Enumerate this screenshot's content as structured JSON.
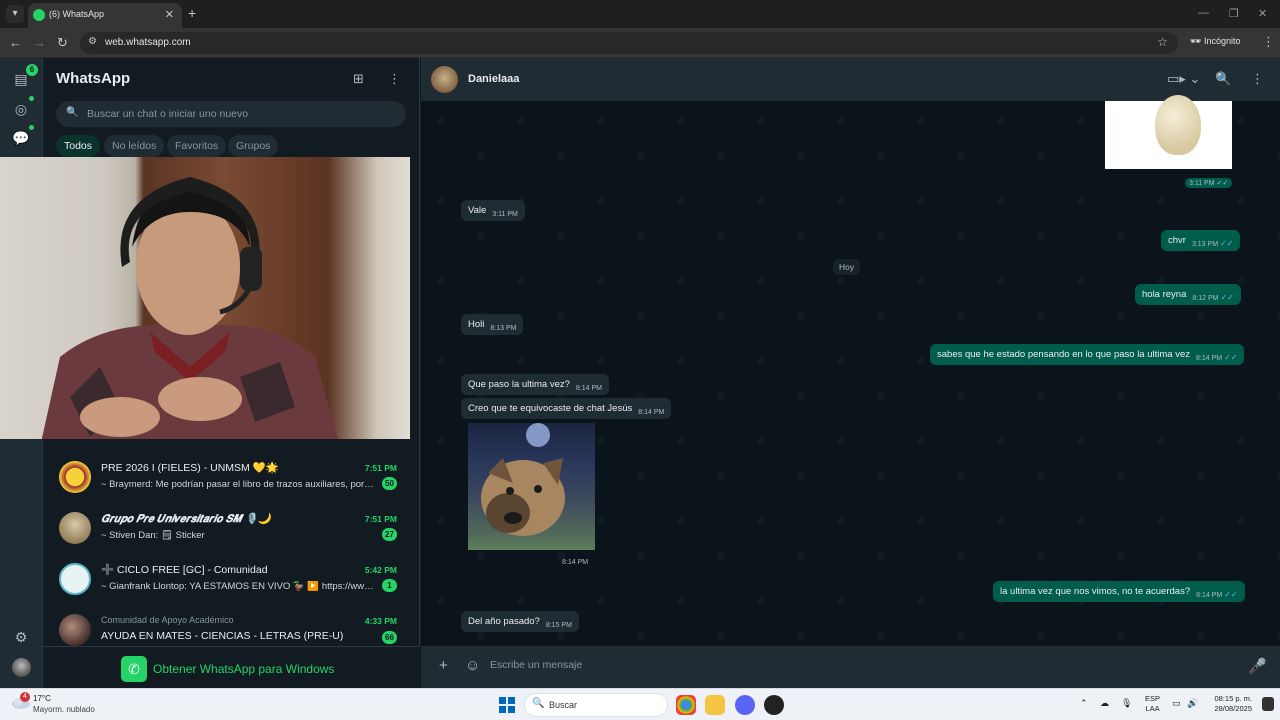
{
  "browser": {
    "tab_title": "(6) WhatsApp",
    "url": "web.whatsapp.com",
    "incognito_label": "Incógnito"
  },
  "rail": {
    "chats_badge": "6"
  },
  "sidebar": {
    "title": "WhatsApp",
    "search_placeholder": "Buscar un chat o iniciar uno nuevo",
    "filters": [
      "Todos",
      "No leídos",
      "Favoritos",
      "Grupos"
    ],
    "chats": [
      {
        "name": "PRE 2026 I (FIELES) - UNMSM 💛🌟",
        "time": "7:51 PM",
        "preview": "~ Braymerd: Me podrían pasar el libro de trazos auxiliares, por fa...",
        "unread": "50"
      },
      {
        "name": "𝑮𝒓𝒖𝒑𝒐 𝑷𝒓𝒆 𝑼𝒏𝒊𝒗𝒆𝒓𝒔𝒊𝒕𝒂𝒓𝒊𝒐 𝑺𝑴 🎙️🌙",
        "time": "7:51 PM",
        "preview": "~ Stiven Dan: 🗒 Sticker",
        "unread": "27"
      },
      {
        "name": "➕ CICLO FREE [GC] - Comunidad",
        "time": "5:42 PM",
        "preview": "~ Gianfrank Llontop: YA ESTAMOS EN VIVO 🦆 ▶️ https://www.y...",
        "unread": "1"
      },
      {
        "community": "Comunidad de Apoyo Académico",
        "name": "AYUDA EN MATES - CIENCIAS - LETRAS (PRE-U)",
        "time": "4:33 PM",
        "unread": "66"
      }
    ],
    "get_app": "Obtener WhatsApp para Windows"
  },
  "conversation": {
    "contact_name": "Danielaaa",
    "day_separator": "Hoy",
    "image_out_time": "3:11 PM",
    "image_in_time": "8:14 PM",
    "messages": [
      {
        "dir": "in",
        "text": "Vale",
        "time": "3:11 PM"
      },
      {
        "dir": "out",
        "text": "chvr",
        "time": "3:13 PM"
      },
      {
        "dir": "out",
        "text": "hola reyna",
        "time": "8:12 PM"
      },
      {
        "dir": "in",
        "text": "Holi",
        "time": "8:13 PM"
      },
      {
        "dir": "out",
        "text": "sabes que he estado pensando en lo que paso la ultima vez",
        "time": "8:14 PM"
      },
      {
        "dir": "in",
        "text": "Que paso la ultima vez?",
        "time": "8:14 PM"
      },
      {
        "dir": "in",
        "text": "Creo que te equivocaste de chat Jesús",
        "time": "8:14 PM"
      },
      {
        "dir": "out",
        "text": "la ultima vez que nos vimos, no te acuerdas?",
        "time": "8:14 PM"
      },
      {
        "dir": "in",
        "text": "Del año pasado?",
        "time": "8:15 PM"
      }
    ],
    "composer_placeholder": "Escribe un mensaje"
  },
  "taskbar": {
    "temperature": "17°C",
    "weather": "Mayorm. nublado",
    "weather_badge": "4",
    "search_label": "Buscar",
    "lang_top": "ESP",
    "lang_bottom": "LAA",
    "time": "08:15 p. m.",
    "date": "28/08/2025"
  },
  "colors": {
    "accent": "#25d366",
    "outgoing_bubble": "#005c4b",
    "incoming_bubble": "#202c33",
    "background": "#111b21"
  }
}
